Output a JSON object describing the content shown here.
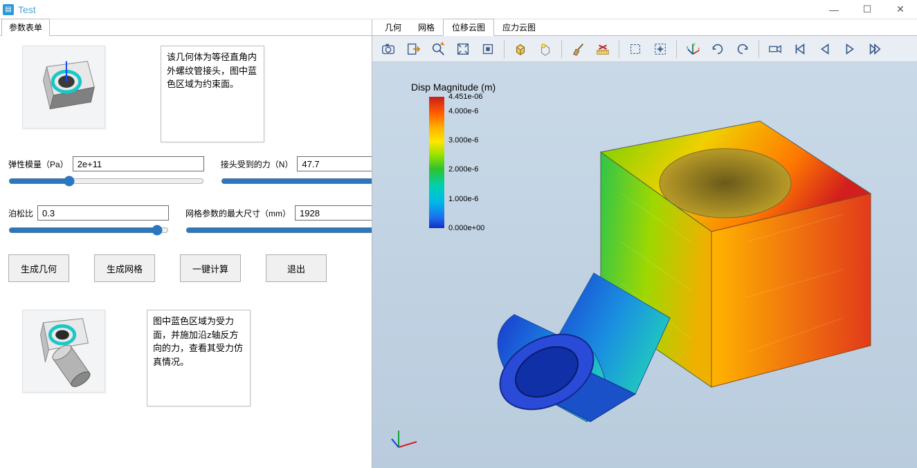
{
  "window": {
    "title": "Test"
  },
  "left": {
    "tab": "参数表单",
    "desc1": "该几何体为等径直角内外螺纹管接头，图中蓝色区域为约束面。",
    "desc2": "图中蓝色区域为受力面，并施加沿z轴反方向的力，查看其受力仿真情况。",
    "params": {
      "elastic": {
        "label": "弹性模量（Pa）",
        "value": "2e+11"
      },
      "force": {
        "label": "接头受到的力（N）",
        "value": "47.7"
      },
      "poisson": {
        "label": "泊松比",
        "value": "0.3"
      },
      "mesh": {
        "label": "网格参数的最大尺寸（mm）",
        "value": "1928"
      }
    },
    "buttons": {
      "gen_geom": "生成几何",
      "gen_mesh": "生成网格",
      "compute": "一键计算",
      "exit": "退出"
    }
  },
  "right": {
    "tabs": {
      "geom": "几何",
      "mesh": "网格",
      "disp": "位移云图",
      "stress": "应力云图"
    },
    "legend": {
      "title": "Disp Magnitude (m)",
      "ticks": [
        "4.451e-06",
        "4.000e-6",
        "3.000e-6",
        "2.000e-6",
        "1.000e-6",
        "0.000e+00"
      ]
    }
  },
  "toolbar_icons": {
    "camera": "camera-icon",
    "export": "export-icon",
    "zoom": "zoom-icon",
    "fit1": "fit-box-icon",
    "fit2": "fit-icon",
    "box3d": "box3d-icon",
    "bulb": "bulb-box-icon",
    "brush": "brush-icon",
    "ruler": "ruler-x-icon",
    "select-rect": "select-rect-icon",
    "select-cross": "select-cross-icon",
    "axes": "axes-icon",
    "rot1": "rotate-cw-icon",
    "rot2": "rotate-ccw-icon",
    "rec": "record-icon",
    "first": "seek-first-icon",
    "prev": "seek-prev-icon",
    "play": "play-icon",
    "last": "seek-last-icon"
  }
}
